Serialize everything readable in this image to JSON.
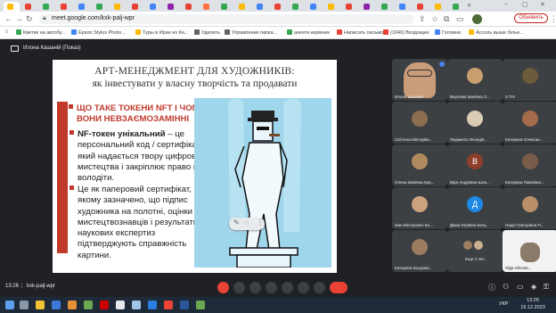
{
  "browser": {
    "url": "meet.google.com/kxk-palj-wpr",
    "update_label": "Обновить",
    "bookmarks": [
      "Квитки на автобу...",
      "Epson Stylus Photo...",
      "Туры в Иран из Ки...",
      "Удалить",
      "Управление папка...",
      "анкета керівник",
      "Написать письмо",
      "(1040) Входящие",
      "Головна",
      "Ассоль выше білье..."
    ]
  },
  "meet": {
    "presenter_name": "Илона Кашаній (Показ)",
    "meeting_code": "kxk-palj-wpr",
    "time": "13:26",
    "slide": {
      "title_line1": "АРТ-МЕНЕДЖМЕНТ ДЛЯ ХУДОЖНИКІВ:",
      "title_line2": "як інвестувати у власну творчість та продавати",
      "heading": "ЩО ТАКЕ ТОКЕНИ NFT І ЧОМУ ВОНИ НЕВЗАЄМОЗАМІННІ",
      "para1_bold": "NF-токен унікальний",
      "para1_rest": " – це персональний код / сертифікат, який надається твору цифрового мистецтва і закріплює право ним володіти.",
      "para2": "Це як паперовий сертифікат, на якому зазначено, що підпис художника на полотні, оцінки мистецтвознавців і результати наукових експертиз підтверджують справжність картини."
    },
    "participants": [
      {
        "name": "Илона Кашаній",
        "kind": "video"
      },
      {
        "name": "Вероніка Іванівна З...",
        "kind": "photo"
      },
      {
        "name": "S TIV",
        "kind": "photo"
      },
      {
        "name": "Світлана Вікторівн...",
        "kind": "photo"
      },
      {
        "name": "Людмила Леонідів...",
        "kind": "photo"
      },
      {
        "name": "Катерина Олексан...",
        "kind": "photo"
      },
      {
        "name": "Олена Іванівна Кра...",
        "kind": "photo"
      },
      {
        "name": "Віра Андріївна Шла...",
        "kind": "letter",
        "letter": "В"
      },
      {
        "name": "Катерина Павлівна...",
        "kind": "photo"
      },
      {
        "name": "Іван Вікторович Бо...",
        "kind": "photo"
      },
      {
        "name": "Діана Юріївна Качу...",
        "kind": "letter",
        "letter": "Д"
      },
      {
        "name": "Надія Григорівна П...",
        "kind": "photo"
      },
      {
        "name": "Катерина Богданів...",
        "kind": "photo"
      },
      {
        "name": "Ещё 4 чел.",
        "kind": "more"
      },
      {
        "name": "Olga Shiman...",
        "kind": "photo"
      }
    ]
  },
  "taskbar": {
    "time": "13:26",
    "date": "19.12.2023",
    "lang": "УКР"
  },
  "colors": {
    "accent_red": "#c0392b",
    "slide_image_bg": "#9fd6ec",
    "end_call": "#ea4335"
  }
}
